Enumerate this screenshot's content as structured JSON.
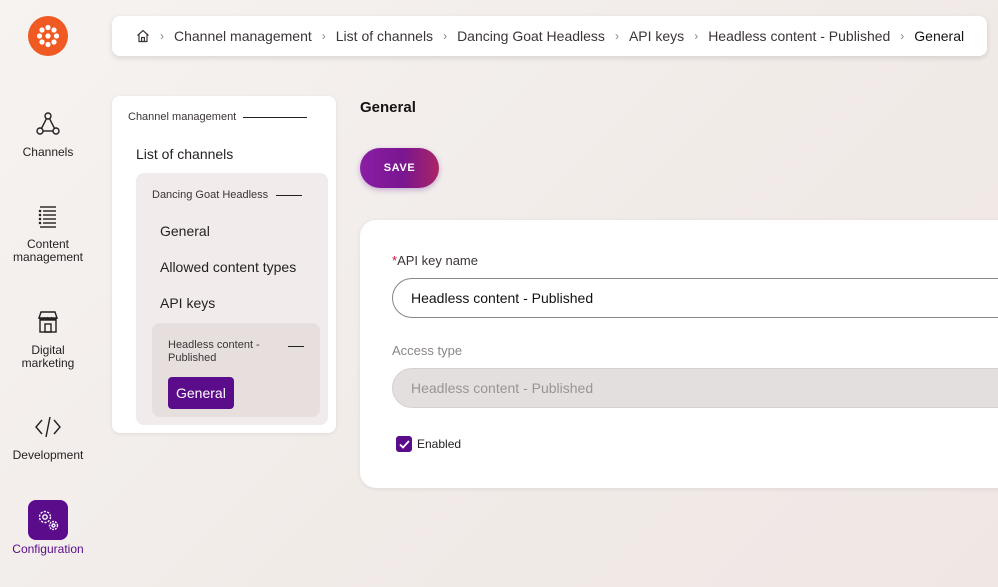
{
  "colors": {
    "accent": "#5b0c8a",
    "brand_logo": "#f05a22",
    "required_marker": "#c4133c"
  },
  "rail": {
    "logo_icon": "kentico-flower-icon",
    "items": [
      {
        "label": "Channels",
        "icon": "channels-icon"
      },
      {
        "label": "Content management",
        "icon": "content-list-icon"
      },
      {
        "label": "Digital marketing",
        "icon": "storefront-icon"
      },
      {
        "label": "Development",
        "icon": "code-icon"
      },
      {
        "label": "Configuration",
        "icon": "cogwheels-icon",
        "active": true
      }
    ]
  },
  "breadcrumb": {
    "home_icon": "home-icon",
    "items": [
      "Channel management",
      "List of channels",
      "Dancing Goat Headless",
      "API keys",
      "Headless content - Published",
      "General"
    ]
  },
  "tree": {
    "heading": "Channel management",
    "list_link": "List of channels",
    "channel": {
      "heading": "Dancing Goat Headless",
      "links": [
        "General",
        "Allowed content types",
        "API keys"
      ],
      "api_key": {
        "heading": "Headless content - Published",
        "selected": "General"
      }
    }
  },
  "main": {
    "title": "General",
    "save_label": "SAVE",
    "form": {
      "api_key_name": {
        "required_marker": "*",
        "label": "API key name",
        "value": "Headless content - Published"
      },
      "access_type": {
        "label": "Access type",
        "value": "Headless content - Published"
      },
      "enabled": {
        "label": "Enabled",
        "checked": true
      }
    }
  }
}
